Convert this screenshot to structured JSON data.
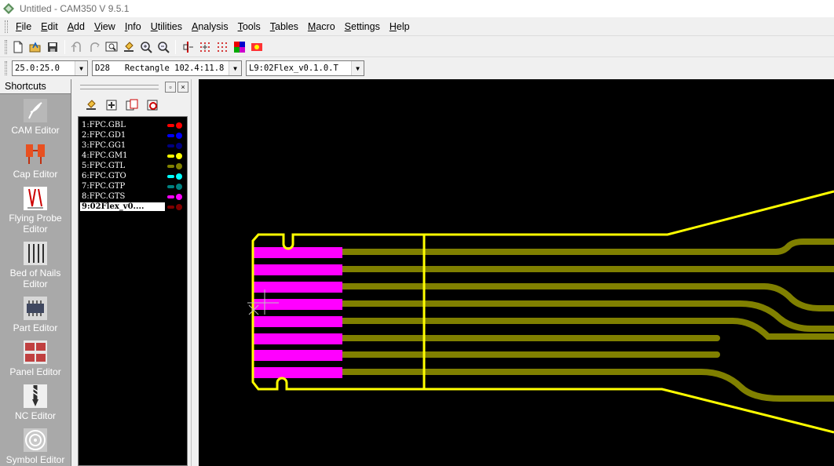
{
  "window": {
    "title": "Untitled - CAM350 V 9.5.1"
  },
  "menu": [
    {
      "ul": "F",
      "rest": "ile"
    },
    {
      "ul": "E",
      "rest": "dit"
    },
    {
      "ul": "A",
      "rest": "dd"
    },
    {
      "ul": "V",
      "rest": "iew"
    },
    {
      "ul": "I",
      "rest": "nfo"
    },
    {
      "ul": "U",
      "rest": "tilities"
    },
    {
      "ul": "A",
      "rest": "nalysis"
    },
    {
      "ul": "T",
      "rest": "ools"
    },
    {
      "ul": "T",
      "rest": "ables"
    },
    {
      "ul": "M",
      "rest": "acro"
    },
    {
      "ul": "S",
      "rest": "ettings"
    },
    {
      "ul": "H",
      "rest": "elp"
    }
  ],
  "toolbar": {
    "icons": [
      "new-icon",
      "open-icon",
      "save-icon",
      "undo-icon",
      "redo-icon",
      "zoom-window-icon",
      "clear-icon",
      "zoom-in-icon",
      "zoom-out-icon",
      "query-icon",
      "grid-icon",
      "grid-snap-icon",
      "layer-colors-icon",
      "highlight-icon"
    ]
  },
  "combos": {
    "zoom": "25.0:25.0",
    "dcode": "D28   Rectangle 102.4:11.8",
    "layer": "L9:02Flex_v0.1.0.T"
  },
  "shortcuts": {
    "header": "Shortcuts",
    "items": [
      {
        "label": "CAM Editor",
        "icon": "cam-editor-icon"
      },
      {
        "label": "Cap Editor",
        "icon": "cap-editor-icon"
      },
      {
        "label": "Flying Probe Editor",
        "icon": "flying-probe-editor-icon"
      },
      {
        "label": "Bed of Nails Editor",
        "icon": "bed-of-nails-editor-icon"
      },
      {
        "label": "Part Editor",
        "icon": "part-editor-icon"
      },
      {
        "label": "Panel Editor",
        "icon": "panel-editor-icon"
      },
      {
        "label": "NC Editor",
        "icon": "nc-editor-icon"
      },
      {
        "label": "Symbol Editor",
        "icon": "symbol-editor-icon"
      }
    ]
  },
  "layer_panel": {
    "pin_label": "▫",
    "close_label": "×",
    "tools": [
      "layer-clean-icon",
      "layer-add-icon",
      "layer-copy-icon",
      "layer-delete-icon"
    ],
    "layers": [
      {
        "name": "1:FPC.GBL",
        "color": "#ff0000",
        "active": false
      },
      {
        "name": "2:FPC.GD1",
        "color": "#0000ff",
        "active": false
      },
      {
        "name": "3:FPC.GG1",
        "color": "#000080",
        "active": false
      },
      {
        "name": "4:FPC.GM1",
        "color": "#ffff00",
        "active": false
      },
      {
        "name": "5:FPC.GTL",
        "color": "#808000",
        "active": false
      },
      {
        "name": "6:FPC.GTO",
        "color": "#00ffff",
        "active": false
      },
      {
        "name": "7:FPC.GTP",
        "color": "#008080",
        "active": false
      },
      {
        "name": "8:FPC.GTS",
        "color": "#ff00ff",
        "active": false
      },
      {
        "name": "9:02Flex_v0....",
        "color": "#800000",
        "active": true
      }
    ]
  },
  "canvas": {
    "background": "#000000",
    "outline_color": "#ffff00",
    "trace_color": "#808000",
    "pad_color": "#ff00ff",
    "crosshair_color": "#c0c0c0"
  }
}
